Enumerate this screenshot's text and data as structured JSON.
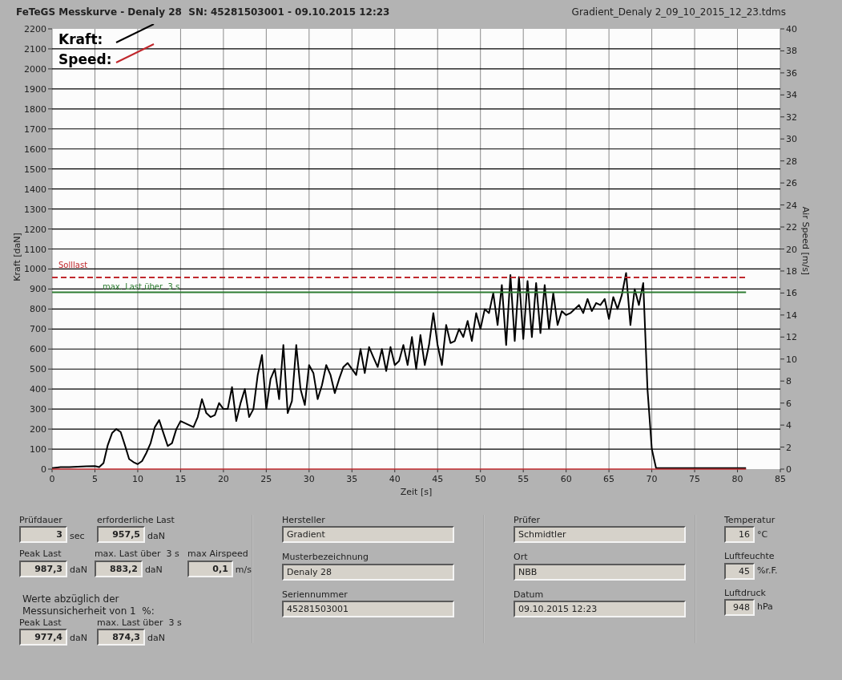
{
  "header": {
    "title": "FeTeGS Messkurve - Denaly 28  SN: 45281503001 - 09.10.2015 12:23",
    "file": "Gradient_Denaly 2_09_10_2015_12_23.tdms"
  },
  "chart": {
    "chart_data": {
      "type": "line",
      "xlabel": "Zeit [s]",
      "ylabel": "Kraft [daN]",
      "y2label": "Air Speed [m/s]",
      "x": [
        0,
        1,
        2,
        3,
        4,
        5,
        5.5,
        6,
        6.5,
        7,
        7.5,
        8,
        8.5,
        9,
        9.5,
        10,
        10.5,
        11,
        11.5,
        12,
        12.5,
        13,
        13.5,
        14,
        14.5,
        15,
        15.5,
        16,
        16.5,
        17,
        17.5,
        18,
        18.5,
        19,
        19.5,
        20,
        20.5,
        21,
        21.5,
        22,
        22.5,
        23,
        23.5,
        24,
        24.5,
        25,
        25.5,
        26,
        26.5,
        27,
        27.5,
        28,
        28.5,
        29,
        29.5,
        30,
        30.5,
        31,
        31.5,
        32,
        32.5,
        33,
        33.5,
        34,
        34.5,
        35,
        35.5,
        36,
        36.5,
        37,
        37.5,
        38,
        38.5,
        39,
        39.5,
        40,
        40.5,
        41,
        41.5,
        42,
        42.5,
        43,
        43.5,
        44,
        44.5,
        45,
        45.5,
        46,
        46.5,
        47,
        47.5,
        48,
        48.5,
        49,
        49.5,
        50,
        50.5,
        51,
        51.5,
        52,
        52.5,
        53,
        53.5,
        54,
        54.5,
        55,
        55.5,
        56,
        56.5,
        57,
        57.5,
        58,
        58.5,
        59,
        59.5,
        60,
        60.5,
        61,
        61.5,
        62,
        62.5,
        63,
        63.5,
        64,
        64.5,
        65,
        65.5,
        66,
        66.5,
        67,
        67.5,
        68,
        68.5,
        69,
        69.5,
        70,
        70.5,
        71,
        72,
        74,
        76,
        78,
        80,
        81
      ],
      "series": [
        {
          "name": "Kraft:",
          "color": "#000000",
          "values": [
            5,
            10,
            10,
            12,
            14,
            15,
            10,
            30,
            120,
            180,
            200,
            185,
            120,
            50,
            35,
            25,
            40,
            80,
            130,
            210,
            245,
            180,
            115,
            130,
            200,
            240,
            230,
            220,
            210,
            260,
            350,
            280,
            260,
            270,
            330,
            300,
            300,
            410,
            240,
            330,
            400,
            260,
            300,
            470,
            570,
            300,
            450,
            500,
            350,
            620,
            280,
            340,
            620,
            400,
            320,
            520,
            480,
            350,
            420,
            520,
            470,
            380,
            450,
            510,
            530,
            500,
            470,
            600,
            480,
            610,
            560,
            510,
            600,
            490,
            610,
            520,
            540,
            620,
            520,
            660,
            500,
            670,
            520,
            620,
            780,
            620,
            520,
            720,
            630,
            640,
            700,
            660,
            740,
            640,
            780,
            700,
            800,
            780,
            880,
            720,
            920,
            620,
            970,
            640,
            960,
            650,
            940,
            660,
            930,
            680,
            920,
            700,
            880,
            720,
            790,
            770,
            780,
            800,
            820,
            780,
            850,
            790,
            830,
            820,
            850,
            750,
            860,
            800,
            870,
            980,
            720,
            900,
            820,
            930,
            400,
            100,
            5,
            5,
            5,
            5,
            5,
            5,
            5,
            5
          ]
        },
        {
          "name": "Speed:",
          "color": "#c0282d",
          "values": [
            0,
            0,
            0,
            0,
            0,
            0,
            0,
            0,
            0,
            0,
            0,
            0,
            0,
            0,
            0,
            0,
            0,
            0,
            0,
            0,
            0,
            0,
            0,
            0,
            0,
            0,
            0,
            0,
            0,
            0,
            0,
            0,
            0,
            0,
            0,
            0,
            0,
            0,
            0,
            0,
            0,
            0,
            0,
            0,
            0,
            0,
            0,
            0,
            0,
            0,
            0,
            0,
            0,
            0,
            0,
            0,
            0,
            0,
            0,
            0,
            0,
            0,
            0,
            0,
            0,
            0,
            0,
            0,
            0,
            0,
            0,
            0,
            0,
            0,
            0,
            0,
            0,
            0,
            0,
            0,
            0,
            0,
            0,
            0,
            0,
            0,
            0,
            0,
            0,
            0,
            0,
            0,
            0,
            0,
            0,
            0,
            0,
            0,
            0,
            0,
            0,
            0,
            0,
            0,
            0,
            0,
            0,
            0,
            0,
            0,
            0,
            0,
            0,
            0,
            0,
            0,
            0,
            0,
            0,
            0,
            0,
            0,
            0,
            0,
            0,
            0,
            0,
            0,
            0,
            0,
            0,
            0,
            0,
            0,
            0,
            0,
            0,
            0,
            0,
            0,
            0,
            0,
            0,
            0
          ]
        },
        {
          "name": "Solllast",
          "color": "#c0282d",
          "line_style": "dashed",
          "values": [
            957.5,
            957.5,
            957.5,
            957.5,
            957.5,
            957.5,
            957.5,
            957.5,
            957.5,
            957.5,
            957.5,
            957.5,
            957.5,
            957.5,
            957.5,
            957.5,
            957.5,
            957.5,
            957.5,
            957.5,
            957.5,
            957.5,
            957.5,
            957.5,
            957.5,
            957.5,
            957.5,
            957.5,
            957.5,
            957.5,
            957.5,
            957.5,
            957.5,
            957.5,
            957.5,
            957.5,
            957.5,
            957.5,
            957.5,
            957.5,
            957.5,
            957.5,
            957.5,
            957.5,
            957.5,
            957.5,
            957.5,
            957.5,
            957.5,
            957.5,
            957.5,
            957.5,
            957.5,
            957.5,
            957.5,
            957.5,
            957.5,
            957.5,
            957.5,
            957.5,
            957.5,
            957.5,
            957.5,
            957.5,
            957.5,
            957.5,
            957.5,
            957.5,
            957.5,
            957.5,
            957.5,
            957.5,
            957.5,
            957.5,
            957.5,
            957.5,
            957.5,
            957.5,
            957.5,
            957.5,
            957.5,
            957.5,
            957.5,
            957.5,
            957.5,
            957.5,
            957.5,
            957.5,
            957.5,
            957.5,
            957.5,
            957.5,
            957.5,
            957.5,
            957.5,
            957.5,
            957.5,
            957.5,
            957.5,
            957.5,
            957.5,
            957.5,
            957.5,
            957.5,
            957.5,
            957.5,
            957.5,
            957.5,
            957.5,
            957.5,
            957.5,
            957.5,
            957.5,
            957.5,
            957.5,
            957.5,
            957.5,
            957.5,
            957.5,
            957.5,
            957.5,
            957.5,
            957.5,
            957.5,
            957.5,
            957.5,
            957.5,
            957.5,
            957.5,
            957.5,
            957.5,
            957.5,
            957.5,
            957.5,
            957.5,
            957.5,
            957.5,
            957.5,
            957.5,
            957.5,
            957.5,
            957.5,
            957.5,
            957.5
          ]
        },
        {
          "name": "max. Last über  3 s",
          "color": "#2e7d32",
          "values": [
            883.2,
            883.2,
            883.2,
            883.2,
            883.2,
            883.2,
            883.2,
            883.2,
            883.2,
            883.2,
            883.2,
            883.2,
            883.2,
            883.2,
            883.2,
            883.2,
            883.2,
            883.2,
            883.2,
            883.2,
            883.2,
            883.2,
            883.2,
            883.2,
            883.2,
            883.2,
            883.2,
            883.2,
            883.2,
            883.2,
            883.2,
            883.2,
            883.2,
            883.2,
            883.2,
            883.2,
            883.2,
            883.2,
            883.2,
            883.2,
            883.2,
            883.2,
            883.2,
            883.2,
            883.2,
            883.2,
            883.2,
            883.2,
            883.2,
            883.2,
            883.2,
            883.2,
            883.2,
            883.2,
            883.2,
            883.2,
            883.2,
            883.2,
            883.2,
            883.2,
            883.2,
            883.2,
            883.2,
            883.2,
            883.2,
            883.2,
            883.2,
            883.2,
            883.2,
            883.2,
            883.2,
            883.2,
            883.2,
            883.2,
            883.2,
            883.2,
            883.2,
            883.2,
            883.2,
            883.2,
            883.2,
            883.2,
            883.2,
            883.2,
            883.2,
            883.2,
            883.2,
            883.2,
            883.2,
            883.2,
            883.2,
            883.2,
            883.2,
            883.2,
            883.2,
            883.2,
            883.2,
            883.2,
            883.2,
            883.2,
            883.2,
            883.2,
            883.2,
            883.2,
            883.2,
            883.2,
            883.2,
            883.2,
            883.2,
            883.2,
            883.2,
            883.2,
            883.2,
            883.2,
            883.2,
            883.2,
            883.2,
            883.2,
            883.2,
            883.2,
            883.2,
            883.2,
            883.2,
            883.2,
            883.2,
            883.2,
            883.2,
            883.2,
            883.2,
            883.2,
            883.2,
            883.2,
            883.2,
            883.2,
            883.2,
            883.2,
            883.2,
            883.2,
            883.2,
            883.2,
            883.2,
            883.2,
            883.2,
            883.2
          ]
        }
      ],
      "xlim": [
        0,
        85
      ],
      "ylim": [
        0,
        2200
      ],
      "y2lim": [
        0,
        40
      ],
      "xticks": [
        0,
        5,
        10,
        15,
        20,
        25,
        30,
        35,
        40,
        45,
        50,
        55,
        60,
        65,
        70,
        75,
        80,
        85
      ],
      "yticks": [
        0,
        100,
        200,
        300,
        400,
        500,
        600,
        700,
        800,
        900,
        1000,
        1100,
        1200,
        1300,
        1400,
        1500,
        1600,
        1700,
        1800,
        1900,
        2000,
        2100,
        2200
      ],
      "y2ticks": [
        0,
        2,
        4,
        6,
        8,
        10,
        12,
        14,
        16,
        18,
        20,
        22,
        24,
        26,
        28,
        30,
        32,
        34,
        36,
        38,
        40
      ],
      "grid": true,
      "legend": "top-left"
    }
  },
  "results": {
    "row_1": [
      {
        "label": "Prüfdauer",
        "value": "3",
        "unit": "sec"
      },
      {
        "label": "erforderliche Last",
        "value": "957,5",
        "unit": "daN"
      }
    ],
    "row_2": [
      {
        "label": "Peak Last",
        "value": "987,3",
        "unit": "daN"
      },
      {
        "label": "max. Last über  3 s",
        "value": "883,2",
        "unit": "daN"
      },
      {
        "label": "max Airspeed",
        "value": "0,1",
        "unit": "m/s"
      }
    ],
    "note": "Werte abzüglich der\nMessunsicherheit von 1  %:",
    "row_3": [
      {
        "label": "Peak Last",
        "value": "977,4",
        "unit": "daN"
      },
      {
        "label": "max. Last über  3 s",
        "value": "874,3",
        "unit": "daN"
      }
    ]
  },
  "sample_fields": [
    {
      "label": "Hersteller",
      "value": "Gradient"
    },
    {
      "label": "Musterbezeichnung",
      "value": "Denaly 28"
    },
    {
      "label": "Seriennummer",
      "value": "45281503001"
    }
  ],
  "test_fields": [
    {
      "label": "Prüfer",
      "value": "Schmidtler"
    },
    {
      "label": "Ort",
      "value": "NBB"
    },
    {
      "label": "Datum",
      "value": "09.10.2015 12:23"
    }
  ],
  "ambient": [
    {
      "label": "Temperatur",
      "value": "16",
      "unit": "°C"
    },
    {
      "label": "Luftfeuchte",
      "value": "45",
      "unit": "%r.F."
    },
    {
      "label": "Luftdruck",
      "value": "948",
      "unit": "hPa"
    }
  ]
}
